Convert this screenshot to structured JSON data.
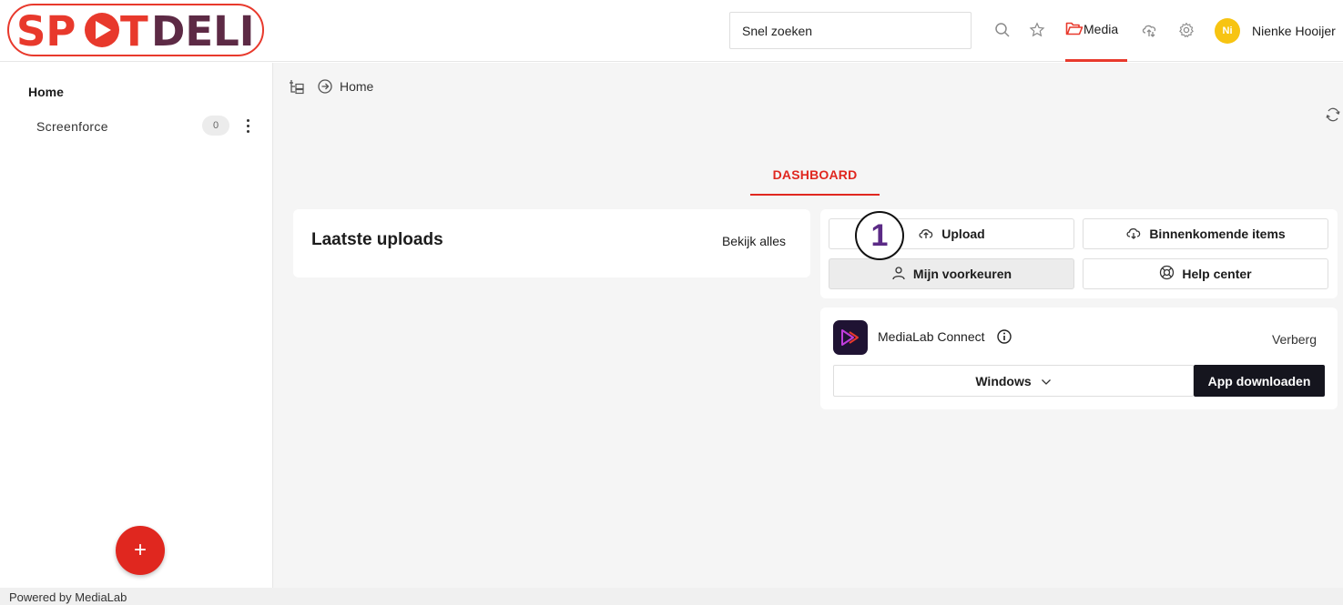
{
  "brand": {
    "logo_text": "SPOTDELI",
    "accent": "#e8392c",
    "logo_dark": "#5d2a45"
  },
  "header": {
    "search": {
      "placeholder": "Snel zoeken"
    },
    "media_label": "Media",
    "avatar_initials": "Ni",
    "user_name": "Nienke Hooijer",
    "icons": [
      "search-icon",
      "star-icon",
      "folder-icon",
      "cloud-sync-icon",
      "gear-icon"
    ]
  },
  "sidebar": {
    "home_label": "Home",
    "items": [
      {
        "label": "Screenforce",
        "count": "0"
      }
    ],
    "fab_label": "+"
  },
  "breadcrumb": {
    "current": "Home"
  },
  "tabs": {
    "dashboard": "DASHBOARD"
  },
  "uploads_card": {
    "title": "Laatste uploads",
    "view_all": "Bekijk alles"
  },
  "actions": {
    "step_badge": "1",
    "upload": "Upload",
    "incoming": "Binnenkomende items",
    "preferences": "Mijn voorkeuren",
    "help": "Help center"
  },
  "connect": {
    "title": "MediaLab Connect",
    "hide": "Verberg",
    "os": "Windows",
    "download": "App downloaden"
  },
  "footer": {
    "text": "Powered by MediaLab"
  }
}
